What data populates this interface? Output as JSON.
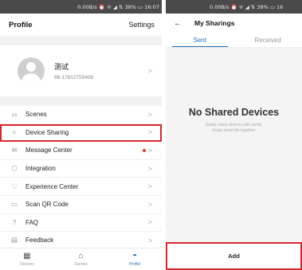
{
  "left": {
    "status_bar": "0.00B/s ⏰ ᯤ ◢ ⇅ 38% ▭ 16:07",
    "header": {
      "title": "Profile",
      "settings_label": "Settings"
    },
    "profile": {
      "name": "测试",
      "phone": "86-17612759408"
    },
    "menu": [
      {
        "icon": "scenes-icon",
        "glyph": "⚏",
        "label": "Scenes"
      },
      {
        "icon": "share-icon",
        "glyph": "<",
        "label": "Device Sharing",
        "highlight": true
      },
      {
        "icon": "message-icon",
        "glyph": "✉",
        "label": "Message Center",
        "dot": true
      },
      {
        "icon": "integration-icon",
        "glyph": "⬡",
        "label": "Integration"
      },
      {
        "icon": "heart-icon",
        "glyph": "♡",
        "label": "Experience Center"
      },
      {
        "icon": "qr-icon",
        "glyph": "▭",
        "label": "Scan QR Code"
      },
      {
        "icon": "faq-icon",
        "glyph": "?",
        "label": "FAQ"
      },
      {
        "icon": "feedback-icon",
        "glyph": "▤",
        "label": "Feedback"
      }
    ],
    "tabbar": [
      {
        "icon": "devices-icon",
        "glyph": "▦",
        "label": "Devices"
      },
      {
        "icon": "home-icon",
        "glyph": "⌂",
        "label": "Scenes"
      },
      {
        "icon": "profile-icon",
        "glyph": "◓",
        "label": "Profile",
        "active": true
      }
    ]
  },
  "right": {
    "status_bar": "0.00B/s ⏰ ᯤ ◢ ⇅ 38% ▭ 16",
    "header": {
      "back": "←",
      "title": "My Sharings"
    },
    "tabs": [
      {
        "label": "Sent",
        "active": true
      },
      {
        "label": "Received"
      }
    ],
    "empty": {
      "title": "No Shared Devices",
      "line1": "Easily share devices with family",
      "line2": "Enjoy smart life together"
    },
    "add_label": "Add"
  },
  "colors": {
    "accent": "#1f6fb7",
    "highlight": "#d9262e",
    "dot": "#e53935"
  },
  "chevron": ">"
}
